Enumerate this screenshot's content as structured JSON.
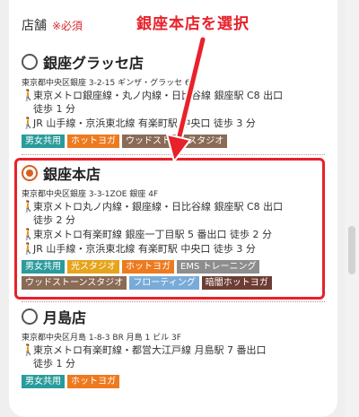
{
  "section": {
    "label": "店舗",
    "required": "※必須"
  },
  "callout": "銀座本店を選択",
  "stores": [
    {
      "name": "銀座グラッセ店",
      "address": "東京都中央区銀座 3-2-15 ギンザ・グラッセ 6F",
      "access": [
        "東京メトロ銀座線・丸ノ内線・日比谷線 銀座駅 C8 出口\n徒歩 1 分",
        "JR 山手線・京浜東北線 有楽町駅 中央口 徒歩 3 分"
      ],
      "tags": [
        "男女共用",
        "ホットヨガ",
        "ウッドストーンスタジオ"
      ]
    },
    {
      "name": "銀座本店",
      "address": "東京都中央区銀座 3-3-1ZOE 銀座 4F",
      "access": [
        "東京メトロ丸ノ内線・銀座線・日比谷線 銀座駅 C8 出口\n徒歩 2 分",
        "東京メトロ有楽町線 銀座一丁目駅 5 番出口 徒歩 2 分",
        "JR 山手線・京浜東北線 有楽町駅 中央口 徒歩 3 分"
      ],
      "tags": [
        "男女共用",
        "光スタジオ",
        "ホットヨガ",
        "EMS トレーニング",
        "ウッドストーンスタジオ",
        "フローティング",
        "暗闇ホットヨガ"
      ]
    },
    {
      "name": "月島店",
      "address": "東京都中央区月島 1-8-3 BR 月島 1 ビル 3F",
      "access": [
        "東京メトロ有楽町線・都営大江戸線 月島駅 7 番出口\n徒歩 1 分"
      ],
      "tags": [
        "男女共用",
        "ホットヨガ"
      ]
    }
  ],
  "selected_store": "銀座本店",
  "colors": {
    "accent": "#d6601f",
    "highlight": "#e8212a",
    "tag_teal": "#2a9b9b",
    "tag_orange": "#ed7a1f",
    "tag_brown": "#8a6b56",
    "tag_yellow": "#e5a41b",
    "tag_gray": "#8d8d8d",
    "tag_blue": "#79abd8",
    "tag_dark": "#6d3d33"
  },
  "icons": {
    "walk": "person-walking-icon"
  }
}
